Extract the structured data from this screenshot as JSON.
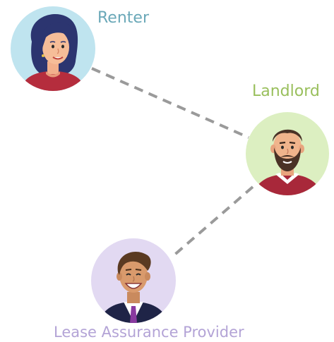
{
  "roles": {
    "renter": {
      "label": "Renter",
      "color": "#6aa8b8",
      "bg_color": "#bfe4ef"
    },
    "landlord": {
      "label": "Landlord",
      "color": "#99bf5c",
      "bg_color": "#dcefc1"
    },
    "provider": {
      "label": "Lease Assurance Provider",
      "color": "#b3a3d6",
      "bg_color": "#e2d9f2"
    }
  },
  "connections": [
    {
      "from": "renter",
      "to": "landlord",
      "style": "dashed",
      "color": "#9a9a9a"
    },
    {
      "from": "landlord",
      "to": "provider",
      "style": "dashed",
      "color": "#9a9a9a"
    }
  ],
  "icons": {
    "renter": "woman-avatar-icon",
    "landlord": "bearded-man-avatar-icon",
    "provider": "smiling-man-avatar-icon"
  }
}
